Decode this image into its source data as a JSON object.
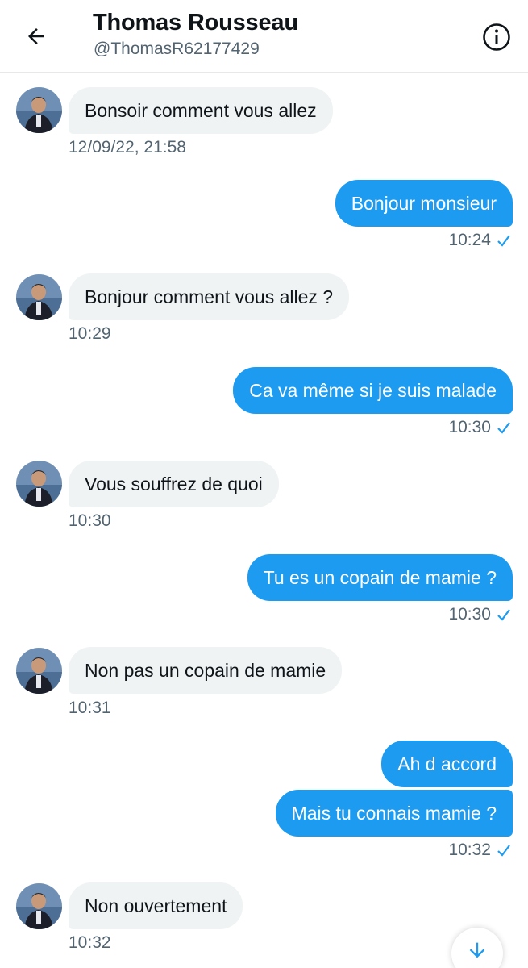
{
  "header": {
    "name": "Thomas Rousseau",
    "handle": "@ThomasR62177429",
    "back_icon": "arrow-left-icon",
    "info_icon": "info-circle-icon"
  },
  "messages": [
    {
      "dir": "in",
      "text": "Bonsoir comment vous allez",
      "time": "12/09/22, 21:58"
    },
    {
      "dir": "out",
      "text": "Bonjour monsieur",
      "time": "10:24"
    },
    {
      "dir": "in",
      "text": "Bonjour comment vous allez ?",
      "time": "10:29"
    },
    {
      "dir": "out",
      "text": "Ca va même si je suis malade",
      "time": "10:30"
    },
    {
      "dir": "in",
      "text": "Vous souffrez de quoi",
      "time": "10:30"
    },
    {
      "dir": "out",
      "text": "Tu es un copain de mamie ?",
      "time": "10:30"
    },
    {
      "dir": "in",
      "text": "Non pas un copain de mamie",
      "time": "10:31"
    },
    {
      "dir": "out",
      "text": "Ah d accord",
      "time": ""
    },
    {
      "dir": "out",
      "text": "Mais tu connais mamie ?",
      "time": "10:32"
    },
    {
      "dir": "in",
      "text": "Non ouvertement",
      "time": "10:32"
    }
  ],
  "colors": {
    "accent": "#1d9bf0",
    "incoming_bubble": "#eff3f4",
    "secondary_text": "#536471"
  },
  "scroll_button_icon": "arrow-down-icon"
}
